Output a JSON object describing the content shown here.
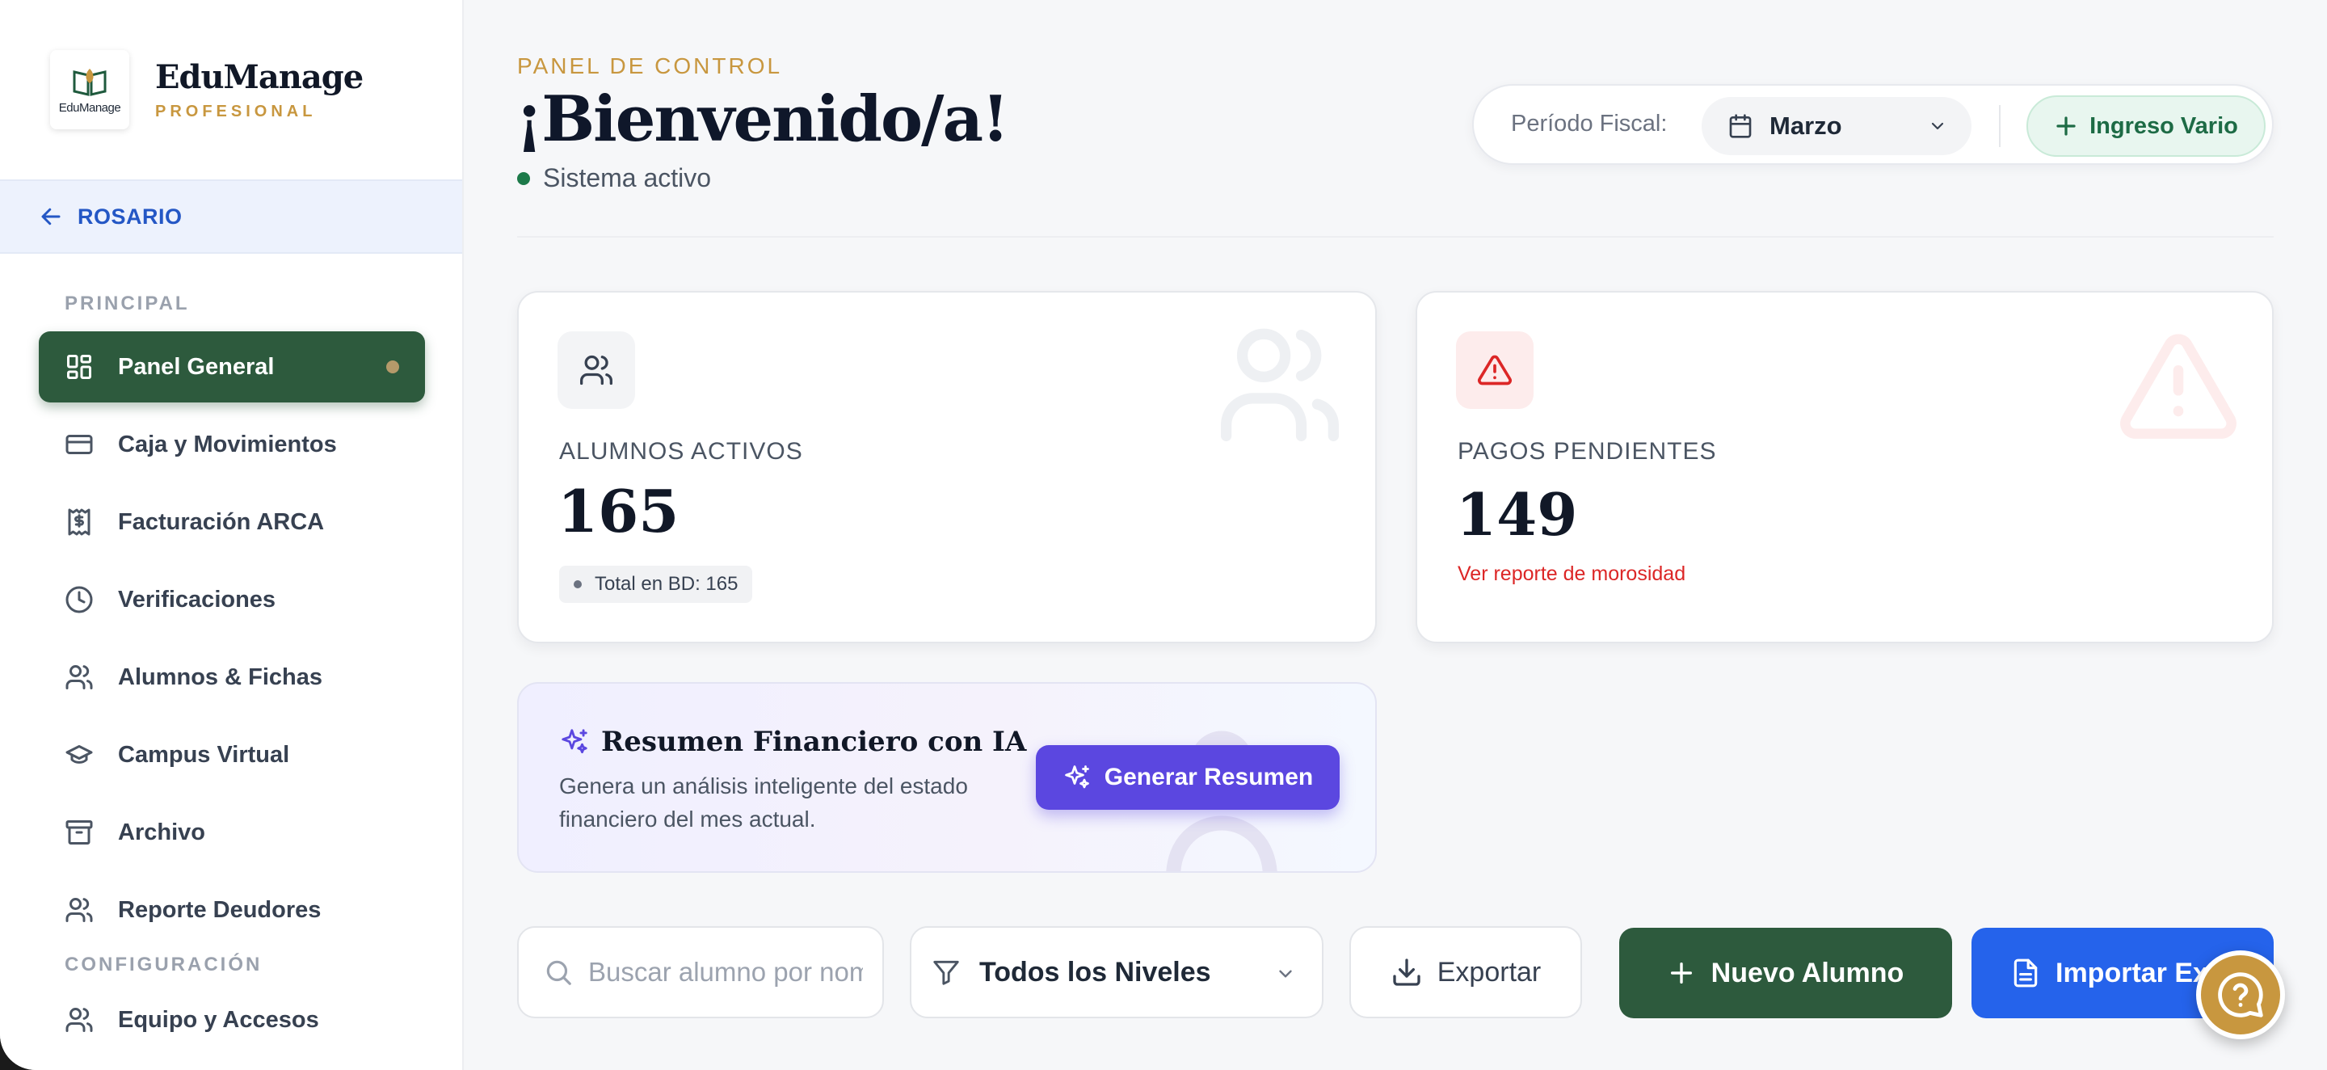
{
  "brand": {
    "logo_text": "EduManage",
    "name": "EduManage",
    "tier": "PROFESIONAL"
  },
  "campus": {
    "label": "ROSARIO"
  },
  "sidebar": {
    "sections": [
      {
        "label": "PRINCIPAL",
        "items": [
          {
            "label": "Panel General",
            "icon": "dashboard-icon",
            "active": true
          },
          {
            "label": "Caja y Movimientos",
            "icon": "credit-card-icon"
          },
          {
            "label": "Facturación ARCA",
            "icon": "receipt-icon"
          },
          {
            "label": "Verificaciones",
            "icon": "clock-icon"
          },
          {
            "label": "Alumnos & Fichas",
            "icon": "users-icon"
          },
          {
            "label": "Campus Virtual",
            "icon": "graduation-cap-icon"
          },
          {
            "label": "Archivo",
            "icon": "archive-icon"
          },
          {
            "label": "Reporte Deudores",
            "icon": "users-icon"
          }
        ]
      },
      {
        "label": "CONFIGURACIÓN",
        "items": [
          {
            "label": "Equipo y Accesos",
            "icon": "users-icon"
          }
        ]
      }
    ]
  },
  "header": {
    "eyebrow": "PANEL DE CONTROL",
    "title": "¡Bienvenido/a!",
    "status": "Sistema activo"
  },
  "topbar": {
    "fiscal_label": "Período Fiscal:",
    "month": "Marzo",
    "ingreso_button": "Ingreso Vario"
  },
  "kpis": {
    "alumnos": {
      "label": "ALUMNOS ACTIVOS",
      "value": "165",
      "badge": "Total en BD: 165"
    },
    "pagos": {
      "label": "PAGOS PENDIENTES",
      "value": "149",
      "link": "Ver reporte de morosidad"
    }
  },
  "ai": {
    "title": "Resumen Financiero con IA",
    "description": "Genera un análisis inteligente del estado financiero del mes actual.",
    "button": "Generar Resumen"
  },
  "toolbar": {
    "search_placeholder": "Buscar alumno por nombre...",
    "level_filter": "Todos los Niveles",
    "export_button": "Exportar",
    "new_button": "Nuevo Alumno",
    "import_button": "Importar Excel"
  },
  "colors": {
    "primary_green": "#2d5a3d",
    "accent_gold": "#c8973f",
    "ai_purple": "#5b47e0",
    "import_blue": "#2563eb",
    "danger_red": "#dc2626"
  }
}
